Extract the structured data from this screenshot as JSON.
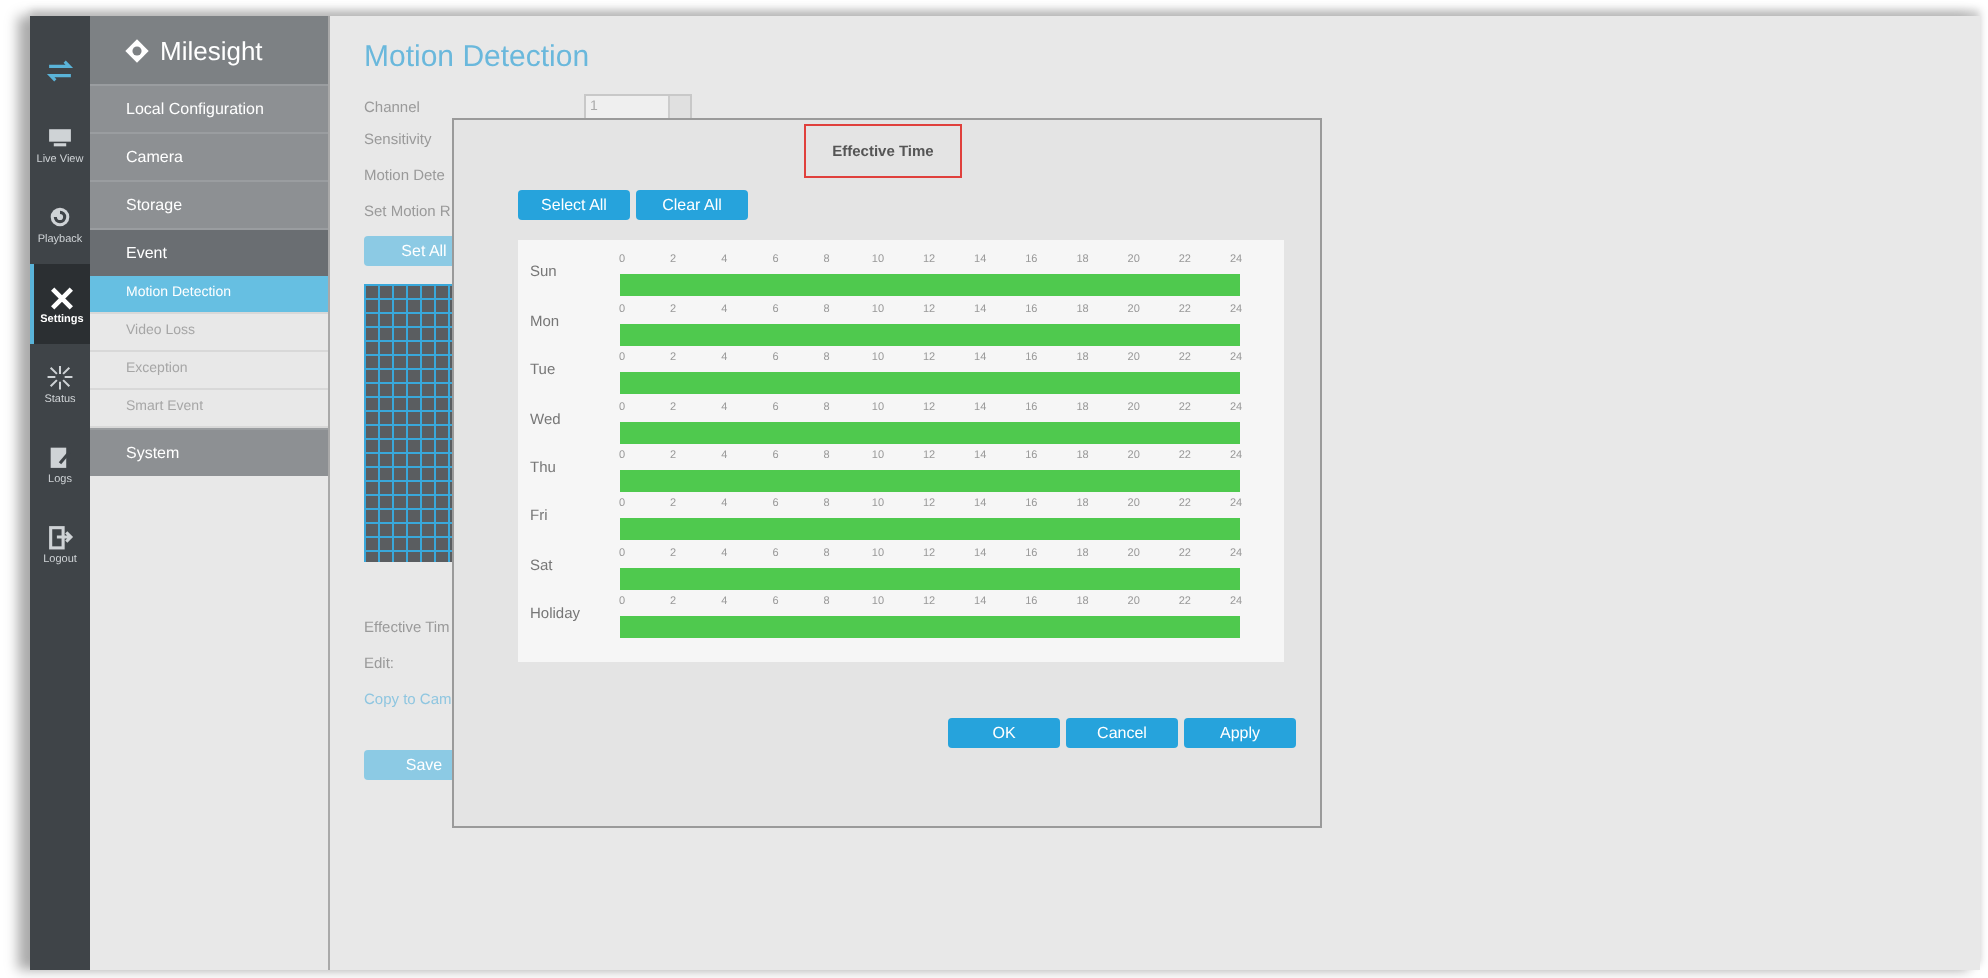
{
  "rail": [
    {
      "kind": "swap",
      "selected": false
    },
    {
      "kind": "liveview",
      "label": "Live View",
      "selected": false
    },
    {
      "kind": "playback",
      "label": "Playback",
      "selected": false
    },
    {
      "kind": "settings",
      "label": "Settings",
      "selected": true
    },
    {
      "kind": "status",
      "label": "Status",
      "selected": false
    },
    {
      "kind": "logs",
      "label": "Logs",
      "selected": false
    },
    {
      "kind": "logout",
      "label": "Logout",
      "selected": false
    }
  ],
  "brand": "Milesight",
  "menu": [
    {
      "label": "Local Configuration",
      "expanded": false
    },
    {
      "label": "Camera",
      "expanded": false
    },
    {
      "label": "Storage",
      "expanded": false
    },
    {
      "label": "Event",
      "expanded": true,
      "children": [
        {
          "label": "Motion Detection",
          "selected": true
        },
        {
          "label": "Video Loss",
          "selected": false
        },
        {
          "label": "Exception",
          "selected": false
        },
        {
          "label": "Smart Event",
          "selected": false
        }
      ]
    },
    {
      "label": "System",
      "expanded": false
    }
  ],
  "page": {
    "title": "Motion Detection",
    "channel": {
      "label": "Channel",
      "value": "1"
    },
    "labels_top": [
      "Sensitivity",
      "Motion Dete",
      "Set Motion R"
    ],
    "set_all_button": "Set All",
    "labels_bottom": [
      "Effective Tim",
      "Edit:"
    ],
    "copy_link": "Copy to Cam",
    "save_button": "Save"
  },
  "dialog": {
    "title": "Effective Time",
    "select_all_button": "Select All",
    "clear_all_button": "Clear All",
    "days": [
      {
        "name": "Sun",
        "level": 1,
        "ticks": [
          "0",
          "2",
          "4",
          "6",
          "8",
          "10",
          "12",
          "14",
          "16",
          "18",
          "20",
          "22",
          "24"
        ]
      },
      {
        "name": "Mon",
        "level": 1,
        "ticks": [
          "0",
          "2",
          "4",
          "6",
          "8",
          "10",
          "12",
          "14",
          "16",
          "18",
          "20",
          "22",
          "24"
        ]
      },
      {
        "name": "Tue",
        "level": 1,
        "ticks": [
          "0",
          "2",
          "4",
          "6",
          "8",
          "10",
          "12",
          "14",
          "16",
          "18",
          "20",
          "22",
          "24"
        ]
      },
      {
        "name": "Wed",
        "level": 1,
        "ticks": [
          "0",
          "2",
          "4",
          "6",
          "8",
          "10",
          "12",
          "14",
          "16",
          "18",
          "20",
          "22",
          "24"
        ]
      },
      {
        "name": "Thu",
        "level": 1,
        "ticks": [
          "0",
          "2",
          "4",
          "6",
          "8",
          "10",
          "12",
          "14",
          "16",
          "18",
          "20",
          "22",
          "24"
        ]
      },
      {
        "name": "Fri",
        "level": 1,
        "ticks": [
          "0",
          "2",
          "4",
          "6",
          "8",
          "10",
          "12",
          "14",
          "16",
          "18",
          "20",
          "22",
          "24"
        ]
      },
      {
        "name": "Sat",
        "level": 1,
        "ticks": [
          "0",
          "2",
          "4",
          "6",
          "8",
          "10",
          "12",
          "14",
          "16",
          "18",
          "20",
          "22",
          "24"
        ]
      },
      {
        "name": "Holiday",
        "level": 1,
        "ticks": [
          "0",
          "2",
          "4",
          "6",
          "8",
          "10",
          "12",
          "14",
          "16",
          "18",
          "20",
          "22",
          "24"
        ]
      }
    ],
    "buttons": [
      "OK",
      "Cancel",
      "Apply"
    ]
  }
}
